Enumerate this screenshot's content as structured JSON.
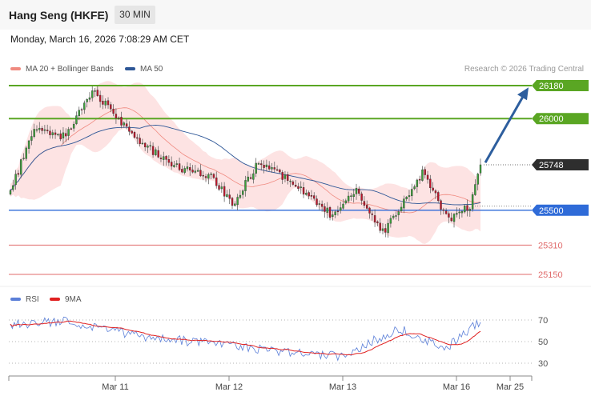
{
  "header": {
    "title": "Hang Seng (HKFE)",
    "timeframe": "30 MIN",
    "datetime": "Monday, March 16, 2026 7:08:29 AM CET"
  },
  "legend": {
    "ma20": {
      "label": "MA 20 + Bollinger Bands",
      "color": "#f08a80"
    },
    "ma50": {
      "label": "MA 50",
      "color": "#2d5696"
    },
    "credit": "Research © 2026 Trading Central"
  },
  "rsi_legend": {
    "rsi": {
      "label": "RSI",
      "color": "#5b7fd8"
    },
    "ma9": {
      "label": "9MA",
      "color": "#e02020"
    }
  },
  "colors": {
    "bull": "#3aa33a",
    "bear": "#c2152b",
    "band": "#fde0e0",
    "resistance": "#5aa623",
    "pivot": "#2f6bd8",
    "support": "#e06b6b",
    "arrow": "#2d5e9e",
    "last_label": "#2e2e2e"
  },
  "chart_data": [
    {
      "type": "candlestick",
      "ylim": [
        25080,
        26260
      ],
      "x_ticks": [
        "Mar 11",
        "Mar 12",
        "Mar 13",
        "Mar 16",
        "Mar 25"
      ],
      "levels": [
        {
          "value": 26180,
          "label": "26180",
          "kind": "resistance"
        },
        {
          "value": 26000,
          "label": "26000",
          "kind": "resistance"
        },
        {
          "value": 25748,
          "label": "25748",
          "kind": "last"
        },
        {
          "value": 25500,
          "label": "25500",
          "kind": "pivot"
        },
        {
          "value": 25310,
          "label": "25310",
          "kind": "support"
        },
        {
          "value": 25150,
          "label": "25150",
          "kind": "support"
        }
      ],
      "arrow": {
        "from": 25760,
        "to": 26170
      },
      "segments": [
        {
          "n": 10,
          "start": 25560,
          "end": 25950
        },
        {
          "n": 12,
          "start": 25950,
          "end": 25900
        },
        {
          "n": 10,
          "start": 25900,
          "end": 26160
        },
        {
          "n": 15,
          "start": 26160,
          "end": 25920
        },
        {
          "n": 15,
          "start": 25920,
          "end": 25740
        },
        {
          "n": 15,
          "start": 25740,
          "end": 25690
        },
        {
          "n": 8,
          "start": 25690,
          "end": 25530
        },
        {
          "n": 10,
          "start": 25530,
          "end": 25760
        },
        {
          "n": 12,
          "start": 25760,
          "end": 25660
        },
        {
          "n": 15,
          "start": 25660,
          "end": 25480
        },
        {
          "n": 10,
          "start": 25480,
          "end": 25600
        },
        {
          "n": 10,
          "start": 25600,
          "end": 25380
        },
        {
          "n": 15,
          "start": 25380,
          "end": 25700
        },
        {
          "n": 10,
          "start": 25700,
          "end": 25450
        },
        {
          "n": 8,
          "start": 25450,
          "end": 25520
        },
        {
          "n": 4,
          "start": 25520,
          "end": 25748
        }
      ],
      "rsi": {
        "ylim": [
          20,
          80
        ],
        "ticks": [
          70,
          50,
          30
        ],
        "segments": [
          {
            "n": 30,
            "start": 65,
            "end": 69
          },
          {
            "n": 40,
            "start": 69,
            "end": 55
          },
          {
            "n": 60,
            "start": 55,
            "end": 43
          },
          {
            "n": 45,
            "start": 43,
            "end": 36
          },
          {
            "n": 30,
            "start": 36,
            "end": 62
          },
          {
            "n": 25,
            "start": 62,
            "end": 44
          },
          {
            "n": 18,
            "start": 44,
            "end": 69
          }
        ]
      }
    }
  ]
}
